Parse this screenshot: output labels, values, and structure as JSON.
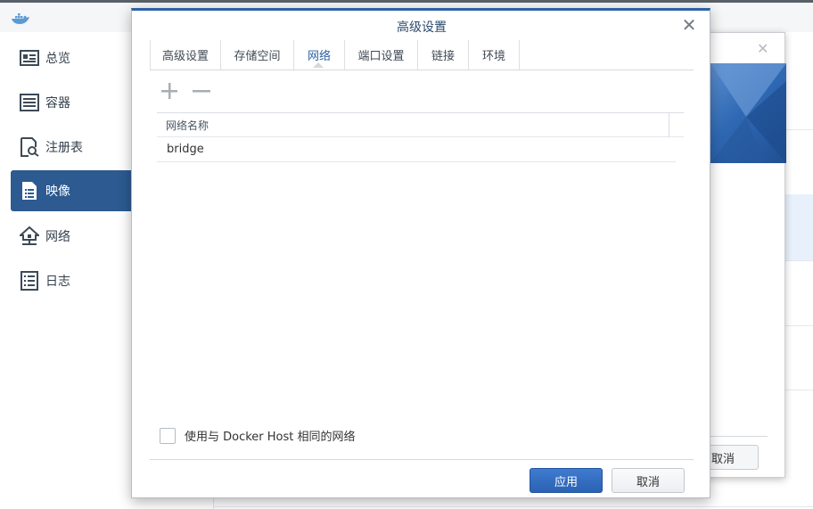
{
  "sidebar": {
    "items": [
      {
        "label": "总览",
        "icon": "overview-icon"
      },
      {
        "label": "容器",
        "icon": "container-icon"
      },
      {
        "label": "注册表",
        "icon": "registry-icon"
      },
      {
        "label": "映像",
        "icon": "image-icon"
      },
      {
        "label": "网络",
        "icon": "network-icon"
      },
      {
        "label": "日志",
        "icon": "log-icon"
      }
    ],
    "active_index": 3
  },
  "background_dialog": {
    "cancel_label": "取消"
  },
  "dialog": {
    "title": "高级设置",
    "tabs": [
      {
        "label": "高级设置"
      },
      {
        "label": "存储空间"
      },
      {
        "label": "网络"
      },
      {
        "label": "端口设置"
      },
      {
        "label": "链接"
      },
      {
        "label": "环境"
      }
    ],
    "active_tab_index": 2,
    "table": {
      "column_header": "网络名称",
      "rows": [
        "bridge"
      ]
    },
    "checkbox_label": "使用与 Docker Host 相同的网络",
    "checkbox_checked": false,
    "apply_label": "应用",
    "cancel_label": "取消"
  },
  "colors": {
    "accent": "#2e62a5",
    "sidebar_active": "#2c5a91"
  }
}
